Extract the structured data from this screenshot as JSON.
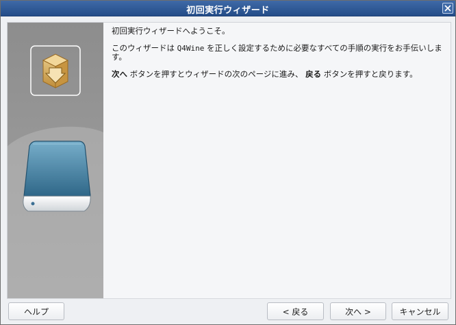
{
  "window": {
    "title": "初回実行ウィザード"
  },
  "intro": {
    "welcome": "初回実行ウィザードへようこそ。",
    "description_prefix": "このウィザードは ",
    "app_name": "Q4Wine",
    "description_suffix": " を正しく設定するために必要なすべての手順の実行をお手伝いします。",
    "next_word": "次へ",
    "instruction_mid": " ボタンを押すとウィザードの次のページに進み、",
    "back_word": "戻る",
    "instruction_end": " ボタンを押すと戻ります。"
  },
  "buttons": {
    "help": "ヘルプ",
    "back": "< 戻る",
    "next": "次へ >",
    "cancel": "キャンセル"
  },
  "icons": {
    "package": "package-install-icon",
    "drive": "hard-drive-icon",
    "close": "close-icon"
  }
}
